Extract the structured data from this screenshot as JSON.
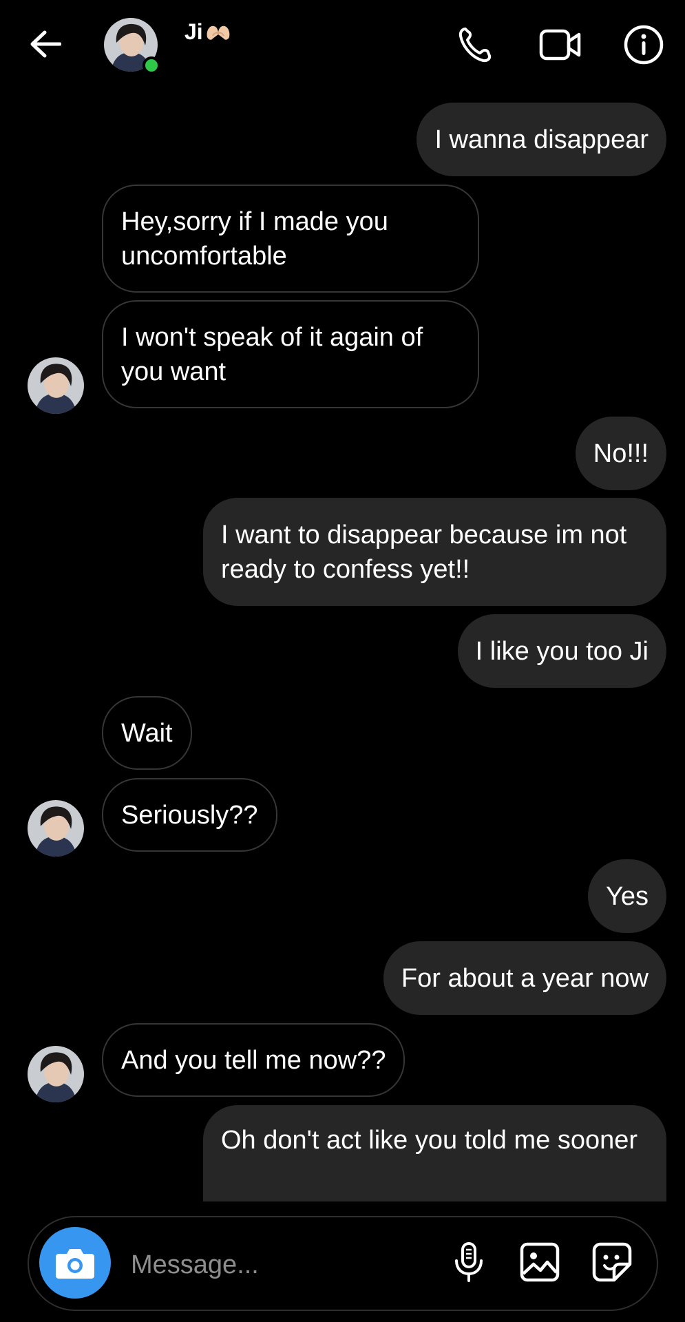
{
  "header": {
    "contact_name": "Ji",
    "name_emoji": "hand-heart",
    "online_status_color": "#2fc94a",
    "icons": [
      "arrow-left-icon",
      "phone-icon",
      "video-camera-icon",
      "info-icon"
    ]
  },
  "messages": [
    {
      "sender": "me",
      "text": "I wanna disappear"
    },
    {
      "sender": "them",
      "text": "Hey,sorry if I made you uncomfortable"
    },
    {
      "sender": "them",
      "text": "I won't speak of it again of you want"
    },
    {
      "sender": "me",
      "text": "No!!!"
    },
    {
      "sender": "me",
      "text": "I want to disappear because im not ready to confess yet!!"
    },
    {
      "sender": "me",
      "text": "I like you too Ji"
    },
    {
      "sender": "them",
      "text": "Wait"
    },
    {
      "sender": "them",
      "text": "Seriously??"
    },
    {
      "sender": "me",
      "text": "Yes"
    },
    {
      "sender": "me",
      "text": "For about a year now"
    },
    {
      "sender": "them",
      "text": "And you tell me now??"
    },
    {
      "sender": "me",
      "text": "Oh don't act like you told me sooner"
    }
  ],
  "composer": {
    "placeholder": "Message...",
    "camera_button_color": "#3797f0",
    "icons": [
      "camera-icon",
      "microphone-icon",
      "gallery-icon",
      "sticker-icon"
    ]
  },
  "colors": {
    "background": "#000000",
    "my_bubble": "#262626",
    "their_bubble_border": "#363636",
    "placeholder": "#8e8e8e"
  }
}
